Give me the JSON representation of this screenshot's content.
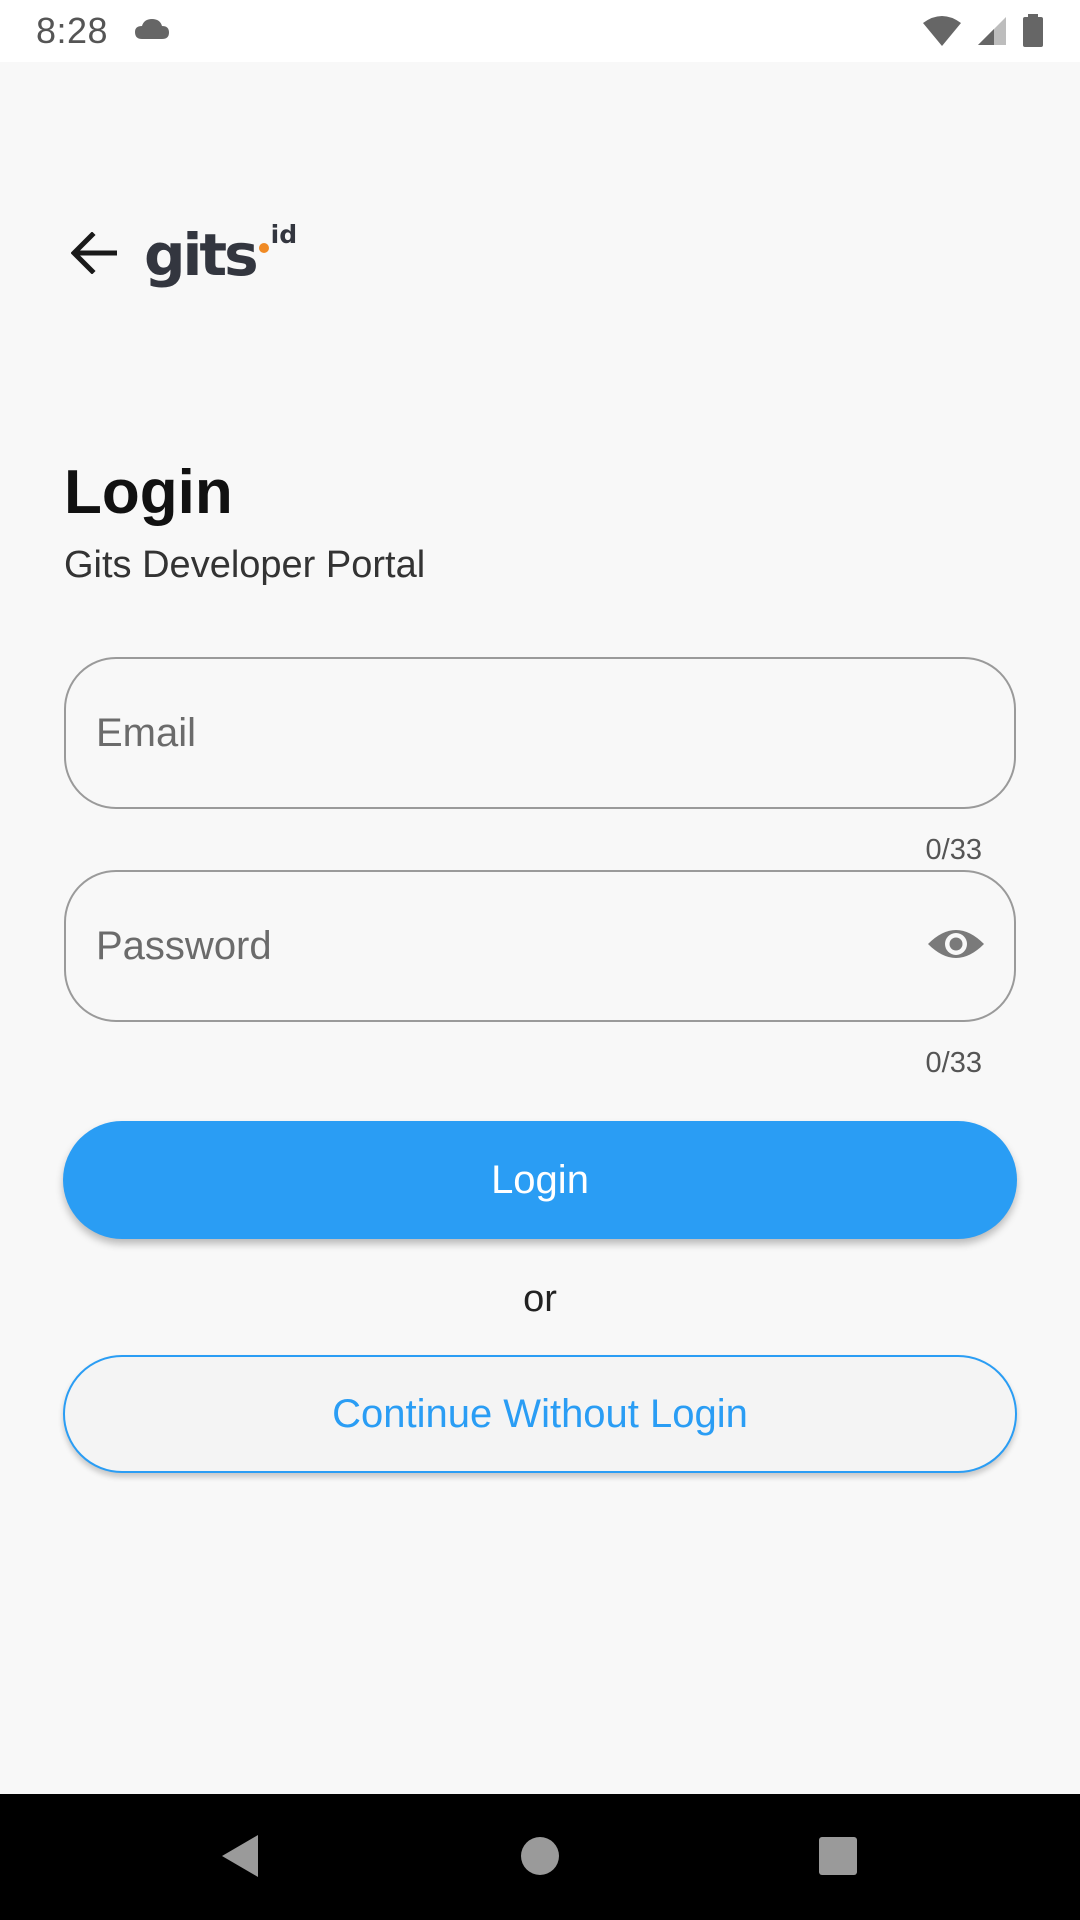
{
  "status_bar": {
    "time": "8:28",
    "icons": [
      "cloud-icon",
      "wifi-icon",
      "signal-icon",
      "battery-icon"
    ]
  },
  "header": {
    "back_icon": "arrow-left-icon",
    "logo": {
      "word": "gits",
      "superscript": "id",
      "dot_color": "#f08a24"
    }
  },
  "title": "Login",
  "subtitle": "Gits Developer Portal",
  "form": {
    "email": {
      "placeholder": "Email",
      "value": "",
      "counter": "0/33"
    },
    "password": {
      "placeholder": "Password",
      "value": "",
      "counter": "0/33",
      "toggle_icon": "eye-icon"
    }
  },
  "actions": {
    "login_label": "Login",
    "separator": "or",
    "continue_label": "Continue Without Login"
  },
  "colors": {
    "accent": "#2a9df4",
    "background": "#f8f8f8",
    "logo_text": "#33363f"
  },
  "nav_bar": {
    "buttons": [
      "back-triangle-icon",
      "home-circle-icon",
      "recents-square-icon"
    ]
  }
}
